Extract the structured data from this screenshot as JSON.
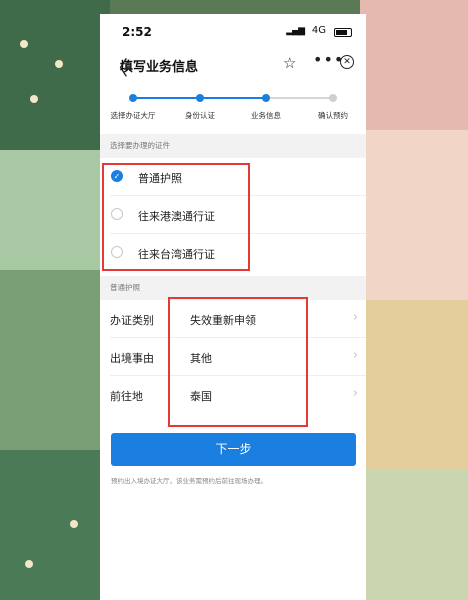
{
  "status_bar": {
    "time": "2:52",
    "network": "4G"
  },
  "nav": {
    "back_glyph": "〈",
    "title": "填写业务信息",
    "star_glyph": "☆",
    "more_glyph": "•••",
    "close_glyph": "✕"
  },
  "steps": [
    {
      "label": "选择办证大厅",
      "done": true
    },
    {
      "label": "身份认证",
      "done": true
    },
    {
      "label": "业务信息",
      "done": true
    },
    {
      "label": "确认预约",
      "done": false
    }
  ],
  "doc_section": {
    "header": "选择要办理的证件",
    "options": [
      {
        "label": "普通护照",
        "selected": true
      },
      {
        "label": "往来港澳通行证",
        "selected": false
      },
      {
        "label": "往来台湾通行证",
        "selected": false
      }
    ]
  },
  "passport_section": {
    "header": "普通护照",
    "fields": [
      {
        "key": "办证类别",
        "value": "失效重新申领"
      },
      {
        "key": "出境事由",
        "value": "其他"
      },
      {
        "key": "前往地",
        "value": "泰国"
      }
    ]
  },
  "next_button": {
    "label": "下一步"
  },
  "footnote": "预约出入境办证大厅，该业务需预约后前往现场办理。",
  "colors": {
    "accent": "#1a7fe0",
    "highlight": "#e53935"
  }
}
